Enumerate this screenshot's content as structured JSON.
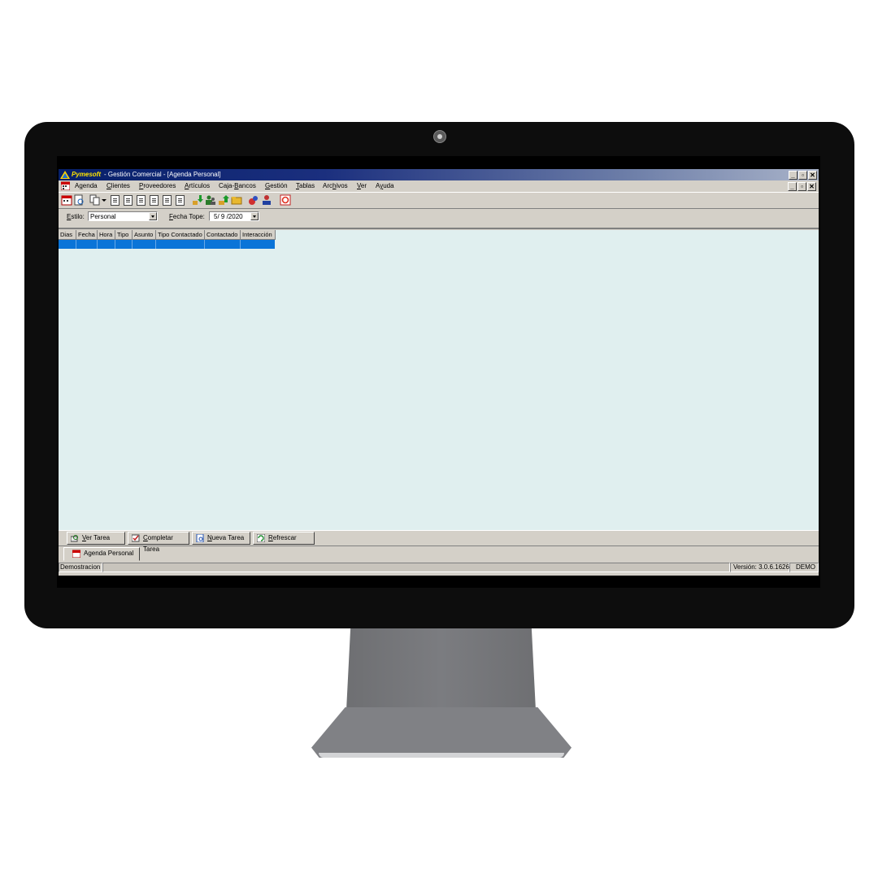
{
  "window": {
    "brand": "Pymesoft",
    "title_rest": " - Gestión Comercial - [Agenda Personal]",
    "controls": [
      "_",
      "🗗",
      "✕"
    ]
  },
  "menu": {
    "items": [
      {
        "pre": "A",
        "ul": "g",
        "post": "enda"
      },
      {
        "pre": "",
        "ul": "C",
        "post": "lientes"
      },
      {
        "pre": "",
        "ul": "P",
        "post": "roveedores"
      },
      {
        "pre": "",
        "ul": "A",
        "post": "rtículos"
      },
      {
        "pre": "Caja-",
        "ul": "B",
        "post": "ancos"
      },
      {
        "pre": "",
        "ul": "G",
        "post": "estión"
      },
      {
        "pre": "",
        "ul": "T",
        "post": "ablas"
      },
      {
        "pre": "Arc",
        "ul": "h",
        "post": "ivos"
      },
      {
        "pre": "",
        "ul": "V",
        "post": "er"
      },
      {
        "pre": "A",
        "ul": "y",
        "post": "uda"
      }
    ]
  },
  "filters": {
    "estilo_label_ul": "E",
    "estilo_label_rest": "stilo:",
    "estilo_value": "Personal",
    "fecha_label_ul": "F",
    "fecha_label_rest": "echa Tope:",
    "fecha_value": "5/ 9 /2020"
  },
  "grid": {
    "columns": [
      "Dias",
      "Fecha",
      "Hora",
      "Tipo",
      "Asunto",
      "Tipo Contactado",
      "Contactado",
      "Interacción"
    ]
  },
  "buttons": {
    "ver_ul": "V",
    "ver_rest": "er Tarea",
    "completar_ul": "C",
    "completar_rest": "ompletar Tarea",
    "nueva_ul": "N",
    "nueva_rest": "ueva Tarea",
    "refrescar_ul": "R",
    "refrescar_rest": "efrescar"
  },
  "tab": {
    "label": "Agenda Personal"
  },
  "status": {
    "left": "Demostracion",
    "version": "Versión: 3.0.6.1626",
    "mode": "DEMO"
  },
  "colors": {
    "grid_bg": "#e0efef",
    "selection": "#0a74d8",
    "title_gradient_start": "#07206a"
  }
}
